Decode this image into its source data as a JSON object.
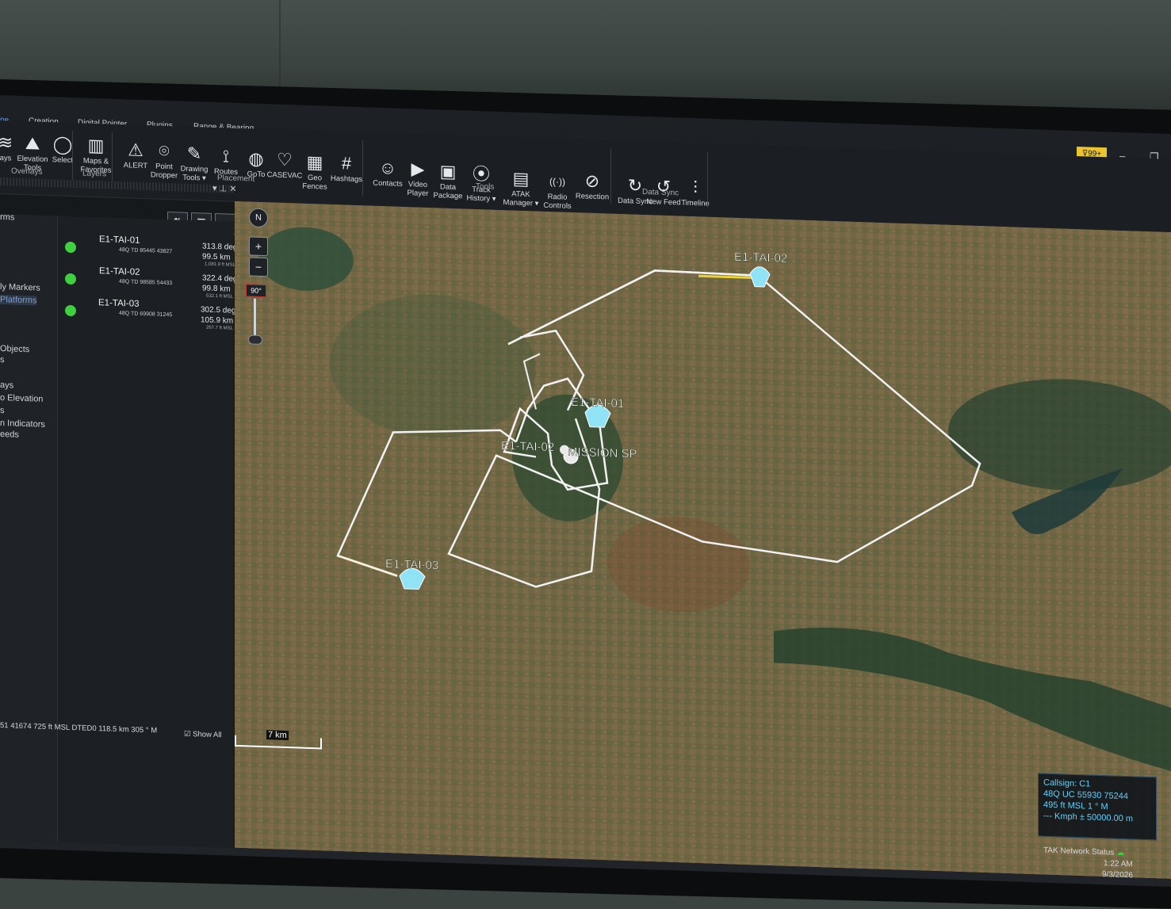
{
  "tabs": [
    {
      "label": "ne",
      "active": true
    },
    {
      "label": "Creation"
    },
    {
      "label": "Digital Pointer"
    },
    {
      "label": "Plugins"
    },
    {
      "label": "Range & Bearing"
    }
  ],
  "notification_badge": "99+",
  "ribbon": {
    "tools": [
      {
        "label": "ays",
        "icon": "layers-icon",
        "glyph": "≋"
      },
      {
        "label": "Elevation Tools",
        "icon": "mountain-icon",
        "glyph": "⛰"
      },
      {
        "label": "Select",
        "icon": "lasso-icon",
        "glyph": "◯"
      },
      {
        "label": "Maps & Favorites",
        "icon": "map-icon",
        "glyph": "▥"
      },
      {
        "label": "ALERT",
        "icon": "alert-icon",
        "glyph": "⚠"
      },
      {
        "label": "Point Dropper",
        "icon": "pin-icon",
        "glyph": "⌾"
      },
      {
        "label": "Drawing Tools ▾",
        "icon": "pencil-icon",
        "glyph": "✎"
      },
      {
        "label": "Routes",
        "icon": "routes-icon",
        "glyph": "⟟"
      },
      {
        "label": "GoTo",
        "icon": "globe-icon",
        "glyph": "◍"
      },
      {
        "label": "CASEVAC",
        "icon": "casevac-icon",
        "glyph": "♡"
      },
      {
        "label": "Geo Fences",
        "icon": "fence-icon",
        "glyph": "▦"
      },
      {
        "label": "Hashtags",
        "icon": "hashtag-icon",
        "glyph": "#"
      },
      {
        "label": "Contacts",
        "icon": "contacts-icon",
        "glyph": "☺"
      },
      {
        "label": "Video Player",
        "icon": "video-icon",
        "glyph": "▶"
      },
      {
        "label": "Data Package",
        "icon": "package-icon",
        "glyph": "▣"
      },
      {
        "label": "Track History ▾",
        "icon": "track-icon",
        "glyph": "⦿"
      },
      {
        "label": "ATAK Manager ▾",
        "icon": "manager-icon",
        "glyph": "▤"
      },
      {
        "label": "Radio Controls",
        "icon": "radio-icon",
        "glyph": "((·))"
      },
      {
        "label": "Resection",
        "icon": "resection-icon",
        "glyph": "⊘"
      },
      {
        "label": "Data Sync",
        "icon": "sync-icon",
        "glyph": "↻"
      },
      {
        "label": "New Feed",
        "icon": "feed-icon",
        "glyph": "↺"
      },
      {
        "label": "Timeline",
        "icon": "timeline-icon",
        "glyph": "⫶"
      }
    ],
    "groups": [
      "Overlays",
      "Layers",
      "Placement",
      "Tools",
      "Data Sync"
    ]
  },
  "left_nav": [
    "rms",
    "ly Markers",
    "Platforms",
    "Objects",
    "s",
    "ays",
    "o Elevation",
    "s",
    "n Indicators",
    "eeds"
  ],
  "rows": [
    {
      "name": "E1-TAI-01",
      "grid": "48Q  TD  85445  43827",
      "deg": "313.8 deg",
      "km": "99.5 km",
      "alt": "1,081.9 ft MSL"
    },
    {
      "name": "E1-TAI-02",
      "grid": "48Q  TD  98585  54433",
      "deg": "322.4 deg",
      "km": "99.8 km",
      "alt": "532.1 ft MSL"
    },
    {
      "name": "E1-TAI-03",
      "grid": "48Q  TD  69908  31245",
      "deg": "302.5 deg",
      "km": "105.9 km",
      "alt": "267.7 ft MSL"
    }
  ],
  "show_all": "Show All",
  "status_line": "51  41674   725 ft MSL DTED0   118.5 km  305 ° M",
  "map": {
    "compass": "N",
    "zoom_in": "+",
    "zoom_out": "−",
    "tilt": "90°",
    "scale": "7 km",
    "labels": {
      "tai01": "E1-TAI-01",
      "tai02": "E1-TAI-02",
      "tai03": "E1-TAI-03",
      "tai02_mid": "E1-TAI-02",
      "mission": "MISSION SP"
    }
  },
  "callsign_box": {
    "line1": "Callsign: C1",
    "line2": "48Q  UC  55930  75244",
    "line3": "495 ft MSL          1 ° M",
    "line4": "--- Kmph  ± 50000.00 m"
  },
  "tray": {
    "network": "TAK Network Status",
    "time": "1:22 AM",
    "date": "9/3/2026"
  },
  "colors": {
    "accent": "#4aa3ff",
    "track_white": "#f2f2f2",
    "track_yellow": "#e8d234",
    "marker": "#8fe3f5",
    "status_green": "#3fcf3f",
    "badge": "#e8c531"
  }
}
